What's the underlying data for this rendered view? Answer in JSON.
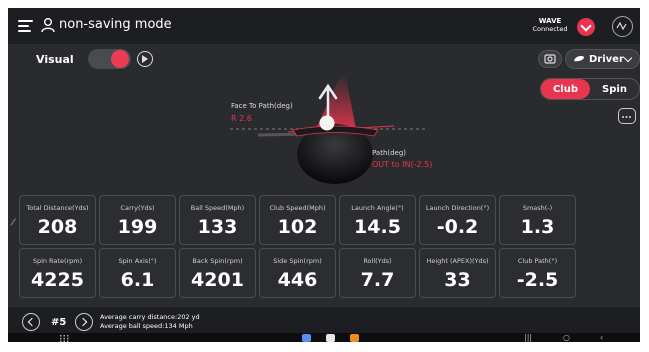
{
  "header": {
    "title": "non-saving mode",
    "status_name": "WAVE",
    "status_text": "Connected"
  },
  "toolbar": {
    "visual_label": "Visual",
    "club_select": "Driver"
  },
  "view_toggle": {
    "options": [
      "Club",
      "Spin"
    ],
    "active": "Club"
  },
  "visualization": {
    "face_to_path_label": "Face To Path(deg)",
    "face_to_path_value": "R 2.6",
    "path_label": "Path(deg)",
    "path_value": "OUT to IN(-2.5)"
  },
  "stats": {
    "row1": [
      {
        "label": "Total Distance(Yds)",
        "value": "208"
      },
      {
        "label": "Carry(Yds)",
        "value": "199"
      },
      {
        "label": "Ball Speed(Mph)",
        "value": "133"
      },
      {
        "label": "Club Speed(Mph)",
        "value": "102"
      },
      {
        "label": "Launch Angle(°)",
        "value": "14.5"
      },
      {
        "label": "Launch Direction(°)",
        "value": "-0.2"
      },
      {
        "label": "Smash(-)",
        "value": "1.3"
      }
    ],
    "row2": [
      {
        "label": "Spin Rate(rpm)",
        "value": "4225"
      },
      {
        "label": "Spin Axis(°)",
        "value": "6.1"
      },
      {
        "label": "Back Spin(rpm)",
        "value": "4201"
      },
      {
        "label": "Side Spin(rpm)",
        "value": "446"
      },
      {
        "label": "Roll(Yds)",
        "value": "7.7"
      },
      {
        "label": "Height (APEX)(Yds)",
        "value": "33"
      },
      {
        "label": "Club Path(°)",
        "value": "-2.5"
      }
    ]
  },
  "footer": {
    "shot_number": "#5",
    "avg_carry": "Average carry distance:202 yd",
    "avg_ball_speed": "Average ball speed:134 Mph"
  },
  "colors": {
    "accent": "#e8344f",
    "background": "#2a2b2e",
    "bar": "#1d1e21"
  }
}
